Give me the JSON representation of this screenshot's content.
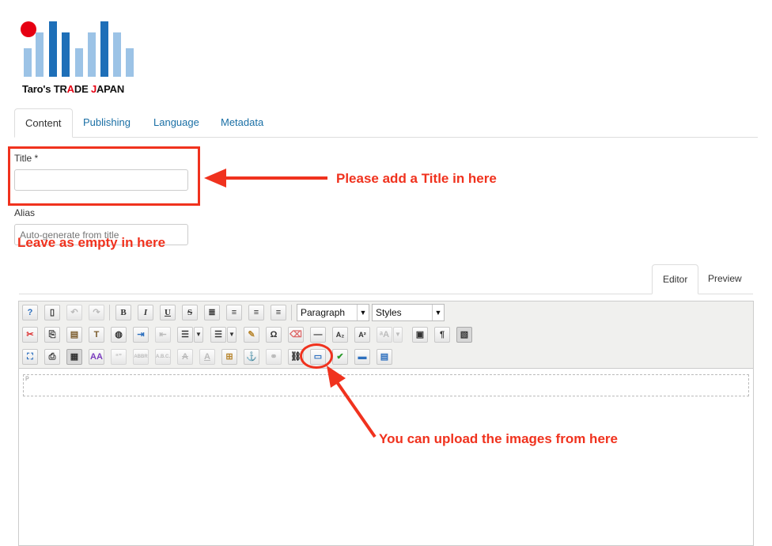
{
  "brand": {
    "logo_text_a": "Taro's TR",
    "logo_text_b": "A",
    "logo_text_c": "DE ",
    "logo_text_d": "J",
    "logo_text_e": "APAN"
  },
  "tabs": [
    {
      "label": "Content",
      "active": true
    },
    {
      "label": "Publishing",
      "active": false
    },
    {
      "label": "Language",
      "active": false
    },
    {
      "label": "Metadata",
      "active": false
    }
  ],
  "form": {
    "title_label": "Title *",
    "title_value": "",
    "alias_label": "Alias",
    "alias_placeholder": "Auto-generate from title"
  },
  "annotations": {
    "title_note": "Please add a Title in here",
    "alias_note": "Leave as empty in here",
    "image_note": "You can upload the images from here"
  },
  "editor_tabs": [
    {
      "label": "Editor",
      "active": true
    },
    {
      "label": "Preview",
      "active": false
    }
  ],
  "toolbar": {
    "format_select": "Paragraph",
    "styles_select": "Styles",
    "bold": "B",
    "italic": "I",
    "underline": "U",
    "strike": "S",
    "omega": "Ω",
    "pilcrow": "¶",
    "subscript": "A₂",
    "superscript": "A²",
    "quote": "“”",
    "abbr": "ABBR",
    "acronym": "A.B.C.",
    "font_color": "A"
  },
  "editor": {
    "path_tag": "P"
  },
  "colors": {
    "annotation_red": "#f0321e",
    "brand_red": "#e60012",
    "bar_dark": "#1e6fb8",
    "bar_light": "#9cc3e6",
    "link_blue": "#1a6fa5"
  }
}
